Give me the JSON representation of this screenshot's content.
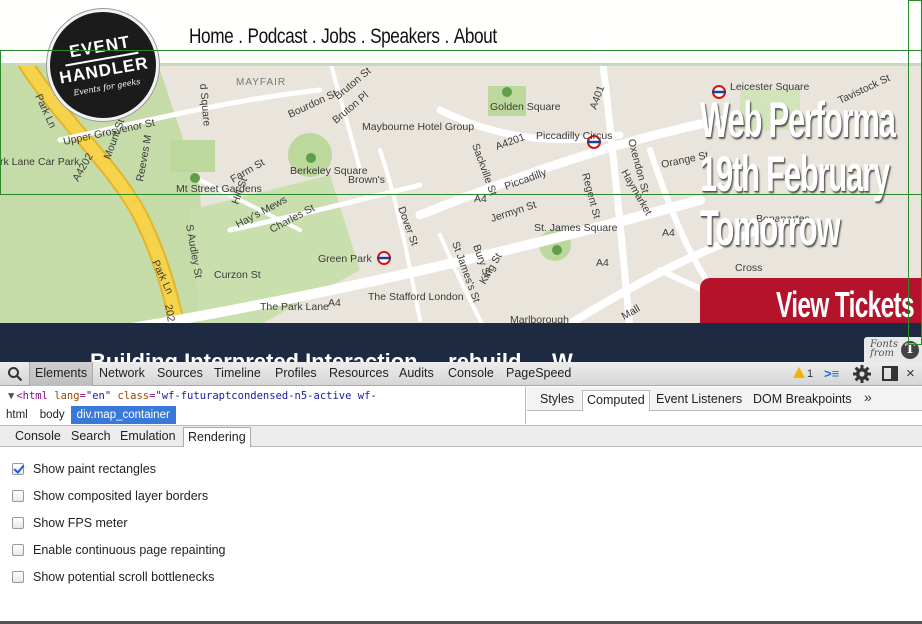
{
  "site": {
    "nav": [
      "Home",
      "Podcast",
      "Jobs",
      "Speakers",
      "About"
    ],
    "nav_separator": ".",
    "logo": {
      "line1": "EVENT",
      "line2": "HANDLER",
      "tagline": "Events for geeks"
    },
    "event_title": [
      "Web Performa",
      "19th February",
      "Tomorrow"
    ],
    "tickets_button": "View Tickets",
    "bottom_band_text": "Building Interpreted Interaction ... rebuild ... W",
    "fonts_badge": {
      "line1": "Fonts",
      "line2": "from"
    },
    "map_labels": {
      "mayfair": "MAYFAIR",
      "upper_grosvenor": "Upper Grosvenor St",
      "park_lane_car_park": "rk Lane Car Park",
      "park_ln": "Park Ln",
      "a4202": "A4202",
      "mt_street_gardens": "Mt Street Gardens",
      "berkeley_square": "Berkeley Square",
      "maybourne": "Maybourne Hotel Group",
      "browns": "Brown's",
      "golden_square": "Golden Square",
      "a4201": "A4201",
      "piccadilly_circus": "Piccadilly Circus",
      "piccadilly": "Piccadilly",
      "leicester_square": "Leicester Square",
      "green_park": "Green Park",
      "st_james_square": "St. James Square",
      "the_stafford": "The Stafford London",
      "the_park_lane": "The Park Lane",
      "curzon_st": "Curzon St",
      "bonapartes": "Bonapartes",
      "cross": "Cross",
      "a4": "A4",
      "regent_st": "Regent St",
      "haymarket": "Haymarket",
      "jermyn_st": "Jermyn St",
      "marlborough": "Marlborough",
      "mall": "Mall",
      "dover_st": "Dover St",
      "bury_st": "Bury St",
      "king_st": "King St",
      "st_jamess_st": "St James's St",
      "orange_st": "Orange St",
      "hays_mews": "Hay's Mews",
      "charles_st": "Charles St",
      "farm_st": "Farm St",
      "s_audley_st": "S Audley St",
      "hill_st": "Hill St",
      "bourdon_st": "Bourdon St",
      "bruton_pl": "Bruton Pl",
      "bruton_st": "Bruton St",
      "sackville_st": "Sackville St",
      "a401": "A401",
      "oxendon_st": "Oxendon St",
      "reeves_m": "Reeves M",
      "mount_st": "Mount St",
      "park_ln2": "Park Ln",
      "a202": "202",
      "d_square": "d Square",
      "tavistock": "Tavistock St"
    }
  },
  "devtools": {
    "toolbar_tabs": [
      "Elements",
      "Network",
      "Sources",
      "Timeline",
      "Profiles",
      "Resources",
      "Audits",
      "Console",
      "PageSpeed"
    ],
    "active_tab": "Elements",
    "warning_count": "1",
    "html_line": {
      "tag_open": "<html",
      "attr1_name": "lang",
      "attr1_value": "\"en\"",
      "attr2_name": "class",
      "attr2_value": "\"wf-futuraptcondensed-n5-active wf-"
    },
    "breadcrumbs": [
      "html",
      "body",
      "div.map_container"
    ],
    "sidebar_tabs": [
      "Styles",
      "Computed",
      "Event Listeners",
      "DOM Breakpoints"
    ],
    "sidebar_active": "Computed",
    "drawer_tabs": [
      "Console",
      "Search",
      "Emulation",
      "Rendering"
    ],
    "drawer_active": "Rendering",
    "rendering_options": [
      {
        "label": "Show paint rectangles",
        "checked": true
      },
      {
        "label": "Show composited layer borders",
        "checked": false
      },
      {
        "label": "Show FPS meter",
        "checked": false
      },
      {
        "label": "Enable continuous page repainting",
        "checked": false
      },
      {
        "label": "Show potential scroll bottlenecks",
        "checked": false
      }
    ]
  },
  "colors": {
    "map_bg": "#e9e5dc",
    "park_green": "#c5dba8",
    "motorway_yellow": "#f6d34a",
    "tickets_red": "#b5122c",
    "band_navy": "#1e2a42",
    "paint_rect_green": "#2a8a2a",
    "breadcrumb_blue": "#3879d9"
  }
}
